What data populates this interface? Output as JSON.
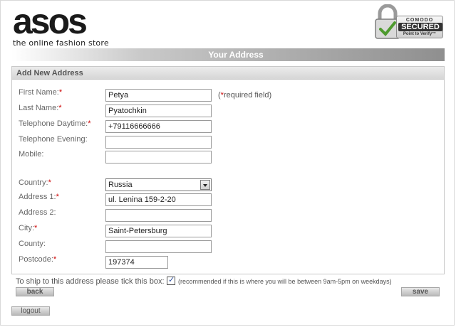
{
  "header": {
    "logo": "asos",
    "tagline": "the online fashion store",
    "badge": {
      "brand": "COMODO",
      "main": "SECURED",
      "sub": "Point to Verify™"
    }
  },
  "title": "Your Address",
  "form": {
    "heading": "Add New Address",
    "required_marker": "*",
    "required_note": "(*required field)",
    "fields": {
      "first_name": {
        "label": "First Name:",
        "value": "Petya"
      },
      "last_name": {
        "label": "Last Name:",
        "value": "Pyatochkin"
      },
      "tel_day": {
        "label": "Telephone Daytime:",
        "value": "+79116666666"
      },
      "tel_eve": {
        "label": "Telephone Evening:",
        "value": ""
      },
      "mobile": {
        "label": "Mobile:",
        "value": ""
      },
      "country": {
        "label": "Country:",
        "value": "Russia"
      },
      "address1": {
        "label": "Address 1:",
        "value": "ul. Lenina 159-2-20"
      },
      "address2": {
        "label": "Address 2:",
        "value": ""
      },
      "city": {
        "label": "City:",
        "value": "Saint-Petersburg"
      },
      "county": {
        "label": "County:",
        "value": ""
      },
      "postcode": {
        "label": "Postcode:",
        "value": "197374"
      }
    }
  },
  "ship": {
    "label": "To ship to this address please tick this box:",
    "note": "(recommended if this is where you will be between 9am-5pm on weekdays)",
    "checked": true
  },
  "buttons": {
    "back": "back",
    "save": "save",
    "logout": "logout"
  }
}
